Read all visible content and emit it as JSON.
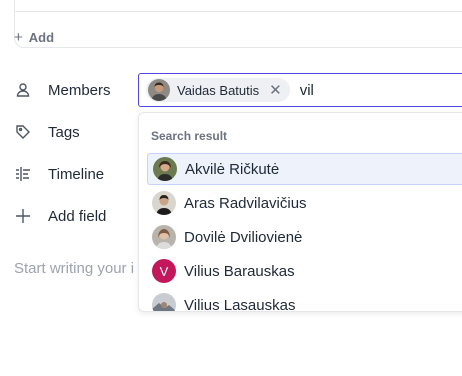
{
  "top_section": {
    "add_label": "Add"
  },
  "properties": {
    "members": "Members",
    "tags": "Tags",
    "timeline": "Timeline",
    "add_field": "Add field"
  },
  "members_field": {
    "selected": [
      {
        "name": "Vaidas Batutis"
      }
    ],
    "query": "vil"
  },
  "search": {
    "header": "Search result",
    "results": [
      {
        "name": "Akvilė Ričkutė",
        "avatar": "photo"
      },
      {
        "name": "Aras Radvilavičius",
        "avatar": "photo"
      },
      {
        "name": "Dovilė Dviliovienė",
        "avatar": "photo"
      },
      {
        "name": "Vilius Barauskas",
        "avatar": "letter",
        "initial": "V",
        "color": "#c2185b"
      },
      {
        "name": "Vilius Lasauskas",
        "avatar": "photo"
      }
    ]
  },
  "editor": {
    "placeholder": "Start writing your i"
  },
  "colors": {
    "accent": "#4f46e5",
    "highlight": "#eef2fb"
  }
}
